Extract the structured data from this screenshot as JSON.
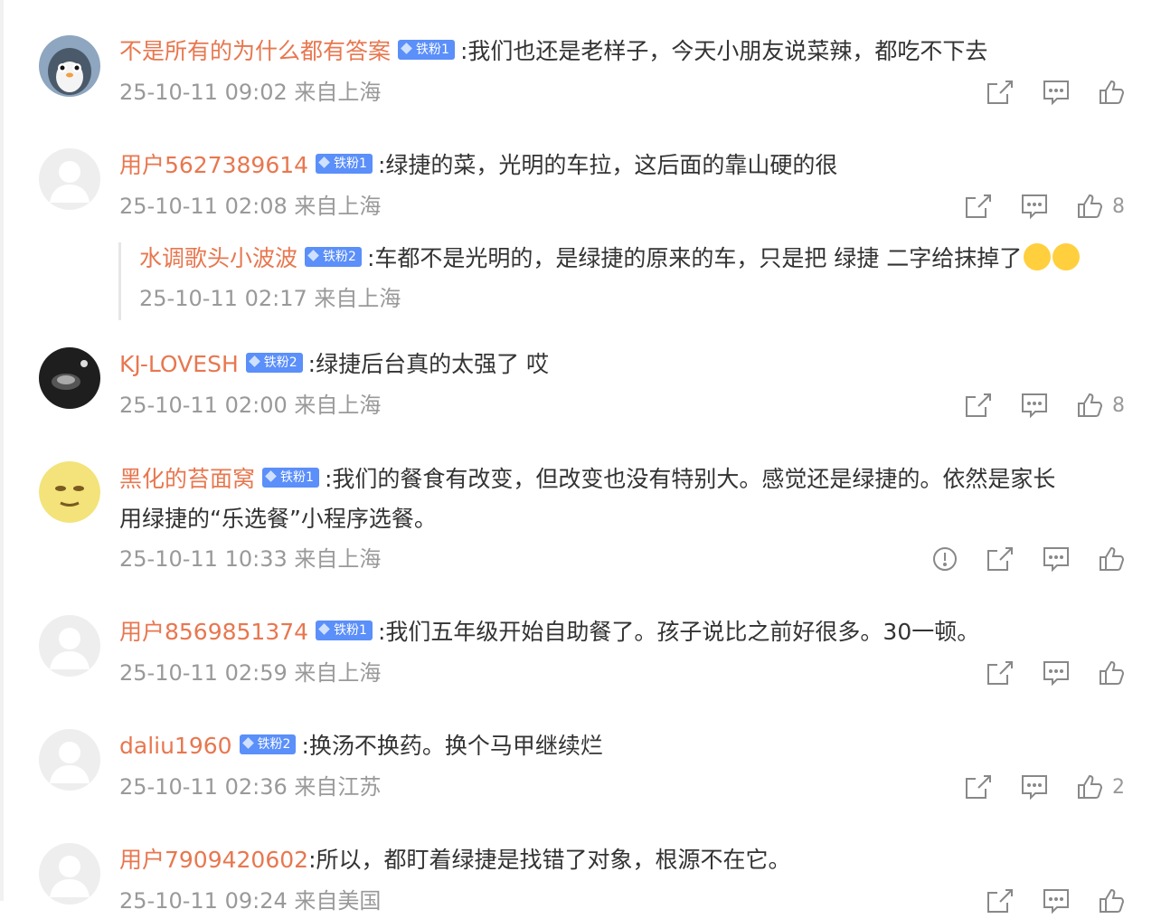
{
  "comments": [
    {
      "user": "不是所有的为什么都有答案",
      "badge": "铁粉1",
      "text": ":我们也还是老样子，今天小朋友说菜辣，都吃不下去",
      "time": "25-10-11 09:02",
      "location": "来自上海",
      "likes": ""
    },
    {
      "user": "用户5627389614",
      "badge": "铁粉1",
      "text": ":绿捷的菜，光明的车拉，这后面的靠山硬的很",
      "time": "25-10-11 02:08",
      "location": "来自上海",
      "likes": "8",
      "reply": {
        "user": "水调歌头小波波",
        "badge": "铁粉2",
        "text": ":车都不是光明的，是绿捷的原来的车，只是把 绿捷 二字给抹掉了",
        "time": "25-10-11 02:17",
        "location": "来自上海"
      }
    },
    {
      "user": "KJ-LOVESH",
      "badge": "铁粉2",
      "text": ":绿捷后台真的太强了 哎",
      "time": "25-10-11 02:00",
      "location": "来自上海",
      "likes": "8"
    },
    {
      "user": "黑化的苔面窝",
      "badge": "铁粉1",
      "text_line1": ":我们的餐食有改变，但改变也没有特别大。感觉还是绿捷的。依然是家长",
      "text_line2": "用绿捷的“乐选餐”小程序选餐。",
      "time": "25-10-11 10:33",
      "location": "来自上海",
      "likes": ""
    },
    {
      "user": "用户8569851374",
      "badge": "铁粉1",
      "text": ":我们五年级开始自助餐了。孩子说比之前好很多。30一顿。",
      "time": "25-10-11 02:59",
      "location": "来自上海",
      "likes": ""
    },
    {
      "user": "daliu1960",
      "badge": "铁粉2",
      "text": ":换汤不换药。换个马甲继续烂",
      "time": "25-10-11 02:36",
      "location": "来自江苏",
      "likes": "2"
    },
    {
      "user": "用户7909420602",
      "text": ":所以，都盯着绿捷是找错了对象，根源不在它。",
      "time": "25-10-11 09:24",
      "location": "来自美国",
      "likes": ""
    }
  ],
  "colors": {
    "username": "#e8774f",
    "meta": "#999999",
    "badge": "#5b8ff9",
    "text": "#333333"
  },
  "icons": [
    "share-icon",
    "comment-icon",
    "like-icon",
    "report-icon"
  ]
}
